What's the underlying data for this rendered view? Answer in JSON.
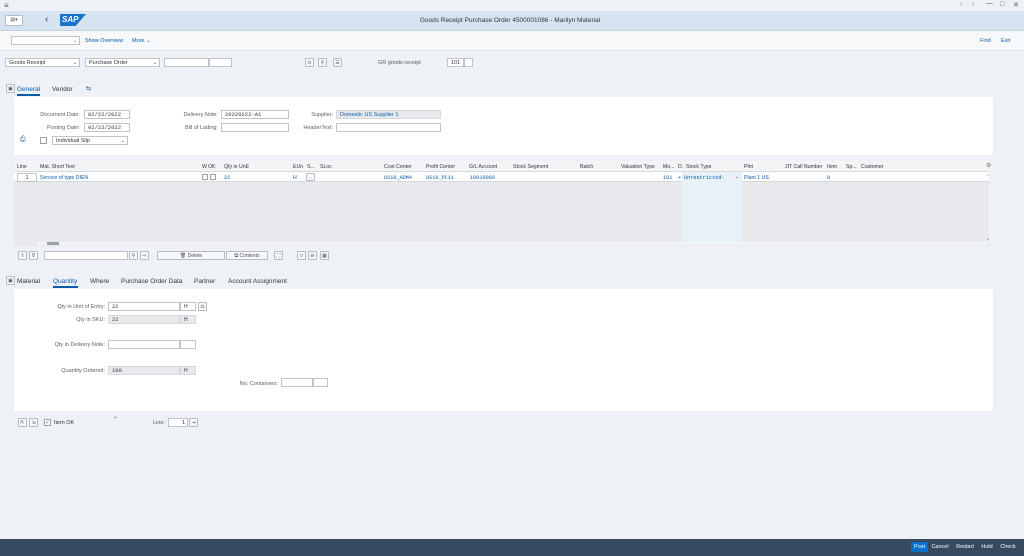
{
  "window": {
    "menu_icon": "hamburger-icon",
    "controls": [
      "‹",
      "›",
      "—",
      "□",
      "✕"
    ]
  },
  "shell": {
    "title": "Goods Receipt Purchase Order 4500001086 - Marilyn Material",
    "logo": "SAP",
    "back_icon": "back-icon"
  },
  "toolbar": {
    "show_overview": "Show Overview",
    "more": "More",
    "find": "Find",
    "exit": "Exit"
  },
  "header": {
    "action": "Goods Receipt",
    "reference": "Purchase Order",
    "gr_label": "GR goods receipt",
    "movement_type": "101"
  },
  "tabs_top": [
    "General",
    "Vendor"
  ],
  "general": {
    "doc_date_label": "Document Date:",
    "doc_date": "02/22/2022",
    "post_date_label": "Posting Date:",
    "post_date": "02/22/2022",
    "slip": "Individual Slip",
    "delivery_note_label": "Delivery Note:",
    "delivery_note": "20220222-A1",
    "bill_label": "Bill of Lading:",
    "supplier_label": "Supplier:",
    "supplier": "Domestic US Supplier 1",
    "header_text_label": "HeaderText:"
  },
  "grid": {
    "columns": [
      "Line",
      "Mat. Short Text",
      "W",
      "OK",
      "Qty in UnE",
      "EUn",
      "S...",
      "SLoc",
      "Cost Center",
      "Profit Center",
      "G/L Account",
      "Stock Segment",
      "Batch",
      "Valuation Type",
      "Mo...",
      "D.",
      "Stock Type",
      "Plnt",
      "JIT Call Number",
      "Item",
      "Sp...",
      "Customer"
    ],
    "row": {
      "line": "1",
      "text": "Service of type DIEN",
      "qty": "22",
      "eun": "H",
      "cost_center": "US10_ADM4",
      "profit_center": "US10_PC11",
      "gl": "10010000",
      "mvt": "101",
      "d": "+",
      "stock_type": "Unrestricted-",
      "plant": "Plant 1 US",
      "item": "0"
    }
  },
  "grid_toolbar": {
    "delete": "Delete",
    "contents": "Contents"
  },
  "tabs_bottom": [
    "Material",
    "Quantity",
    "Where",
    "Purchase Order Data",
    "Partner",
    "Account Assignment"
  ],
  "quantity": {
    "entry_label": "Qty in Unit of Entry:",
    "entry": "22",
    "entry_unit": "H",
    "sku_label": "Qty in SKU:",
    "sku": "22",
    "sku_unit": "H",
    "delivery_label": "Qty in Delivery Note:",
    "ordered_label": "Quantity Ordered:",
    "ordered": "100",
    "ordered_unit": "H",
    "containers_label": "No. Containers:"
  },
  "item_bar": {
    "item_ok": "Item OK",
    "line_label": "Line:",
    "line": "1"
  },
  "footer": {
    "post": "Post",
    "cancel": "Cancel",
    "restart": "Restart",
    "hold": "Hold",
    "check": "Check"
  },
  "colors": {
    "shell": "#d6e3f0",
    "footer": "#354a5f",
    "accent": "#0a5ca8"
  }
}
